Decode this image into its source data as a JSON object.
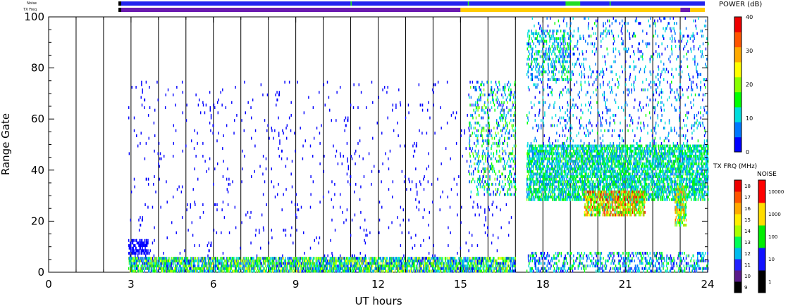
{
  "header": {
    "noise_label": "Noise",
    "txfreq_label": "TX Freq"
  },
  "chart_data": {
    "type": "heatmap",
    "title": "",
    "xlabel": "UT hours",
    "ylabel": "Range Gate",
    "xlim": [
      0,
      24
    ],
    "ylim": [
      0,
      100
    ],
    "x_ticks": [
      "0",
      "3",
      "6",
      "9",
      "12",
      "15",
      "18",
      "21",
      "24"
    ],
    "y_ticks": [
      "0",
      "20",
      "40",
      "60",
      "80",
      "100"
    ],
    "scan_boundaries_ut": [
      1,
      2,
      3,
      4,
      5,
      6,
      7,
      8,
      9,
      10,
      11,
      12,
      13,
      14,
      15,
      16,
      17,
      18,
      19,
      20,
      21,
      22,
      23
    ],
    "colorbars": {
      "power": {
        "label": "POWER (dB)",
        "range": [
          0,
          40
        ],
        "ticks": [
          "0",
          "10",
          "20",
          "30",
          "40"
        ],
        "colors": [
          "#0000ff",
          "#0077ff",
          "#00dddd",
          "#00ff00",
          "#88ff00",
          "#ffff00",
          "#ffaa00",
          "#ff5500",
          "#ee0000"
        ]
      },
      "tx_freq": {
        "label": "TX FRQ (MHz)",
        "ticks": [
          "9",
          "10",
          "11",
          "12",
          "13",
          "14",
          "15",
          "16",
          "17",
          "18"
        ],
        "colors": [
          "#000000",
          "#5a1a8a",
          "#2222ff",
          "#00bbee",
          "#00ff55",
          "#aaff00",
          "#ffee00",
          "#ffaa00",
          "#ff5500",
          "#ee0000"
        ]
      },
      "noise": {
        "label": "NOISE",
        "ticks": [
          "1",
          "10",
          "100",
          "1000",
          "10000"
        ],
        "colors": [
          "#000000",
          "#1111ff",
          "#00ee00",
          "#ffdd00",
          "#ff0000"
        ]
      }
    },
    "noise_strip": {
      "base_color": "#2222ee",
      "green_segments_ut": [
        [
          18.3,
          18.9
        ],
        [
          9.5,
          9.55
        ],
        [
          14.3,
          14.35
        ],
        [
          20.1,
          20.15
        ]
      ]
    },
    "txfreq_strip": {
      "segments": [
        {
          "from": 0,
          "to": 14.0,
          "color": "#6a1ab0"
        },
        {
          "from": 14.0,
          "to": 23.0,
          "color": "#ffcc00"
        },
        {
          "from": 23.0,
          "to": 23.4,
          "color": "#6a1ab0"
        },
        {
          "from": 23.4,
          "to": 24.0,
          "color": "#ffcc00"
        }
      ]
    },
    "scatter_regions": [
      {
        "ut": [
          2.9,
          17.0
        ],
        "gate": [
          0,
          6
        ],
        "density": 0.55,
        "power": [
          2,
          24
        ]
      },
      {
        "ut": [
          2.9,
          3.6
        ],
        "gate": [
          7,
          13
        ],
        "density": 0.45,
        "power": [
          0,
          4
        ]
      },
      {
        "ut": [
          2.9,
          17.0
        ],
        "gate": [
          6,
          75
        ],
        "density": 0.012,
        "power": [
          0,
          4
        ]
      },
      {
        "ut": [
          15.3,
          17.0
        ],
        "gate": [
          30,
          75
        ],
        "density": 0.12,
        "power": [
          3,
          20
        ]
      },
      {
        "ut": [
          17.4,
          24.0
        ],
        "gate": [
          28,
          50
        ],
        "density": 0.45,
        "power": [
          6,
          18
        ]
      },
      {
        "ut": [
          19.5,
          21.7
        ],
        "gate": [
          22,
          32
        ],
        "density": 0.5,
        "power": [
          12,
          38
        ]
      },
      {
        "ut": [
          22.8,
          23.2
        ],
        "gate": [
          18,
          34
        ],
        "density": 0.5,
        "power": [
          8,
          34
        ]
      },
      {
        "ut": [
          17.4,
          24.0
        ],
        "gate": [
          50,
          100
        ],
        "density": 0.05,
        "power": [
          0,
          14
        ]
      },
      {
        "ut": [
          17.4,
          19.0
        ],
        "gate": [
          75,
          95
        ],
        "density": 0.15,
        "power": [
          5,
          16
        ]
      },
      {
        "ut": [
          17.4,
          24.0
        ],
        "gate": [
          0,
          8
        ],
        "density": 0.2,
        "power": [
          0,
          18
        ]
      }
    ]
  }
}
